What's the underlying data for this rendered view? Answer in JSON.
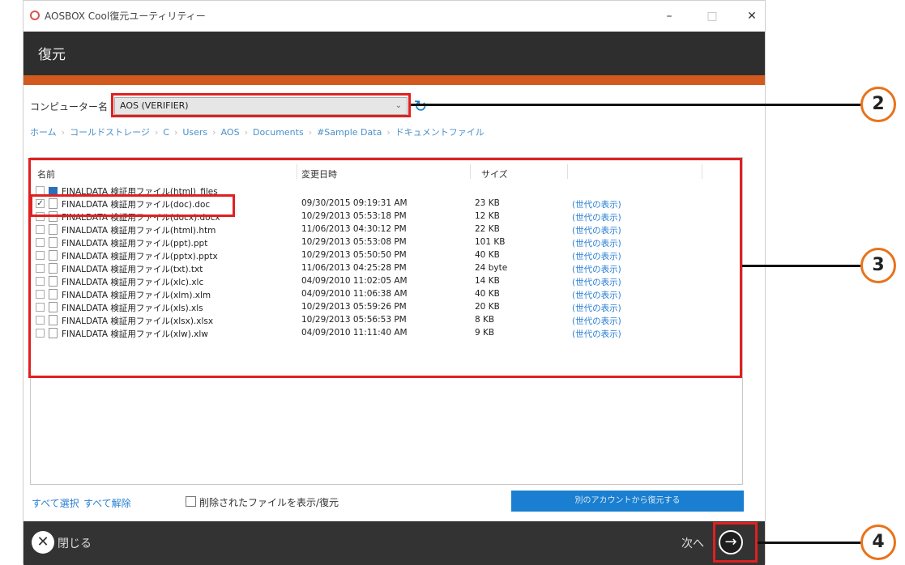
{
  "window": {
    "title": "AOSBOX Cool復元ユーティリティー",
    "minimize": "–",
    "maximize": "□",
    "close": "✕"
  },
  "header": {
    "title": "復元"
  },
  "computer": {
    "label": "コンピューター名",
    "selected": "AOS (VERIFIER)",
    "refresh_glyph": "↻"
  },
  "breadcrumb": [
    "ホーム",
    "コールドストレージ",
    "C",
    "Users",
    "AOS",
    "Documents",
    "#Sample Data",
    "ドキュメントファイル"
  ],
  "table": {
    "headers": {
      "name": "名前",
      "modified": "変更日時",
      "size": "サイズ"
    },
    "rows": [
      {
        "name": "FINALDATA 検証用ファイル(html)_files",
        "date": "",
        "size": "",
        "gen": "",
        "folder": true,
        "checked": false
      },
      {
        "name": "FINALDATA 検証用ファイル(doc).doc",
        "date": "09/30/2015 09:19:31 AM",
        "size": "23 KB",
        "gen": "(世代の表示)",
        "folder": false,
        "checked": true
      },
      {
        "name": "FINALDATA 検証用ファイル(docx).docx",
        "date": "10/29/2013 05:53:18 PM",
        "size": "12 KB",
        "gen": "(世代の表示)",
        "folder": false,
        "checked": false
      },
      {
        "name": "FINALDATA 検証用ファイル(html).htm",
        "date": "11/06/2013 04:30:12 PM",
        "size": "22 KB",
        "gen": "(世代の表示)",
        "folder": false,
        "checked": false
      },
      {
        "name": "FINALDATA 検証用ファイル(ppt).ppt",
        "date": "10/29/2013 05:53:08 PM",
        "size": "101 KB",
        "gen": "(世代の表示)",
        "folder": false,
        "checked": false
      },
      {
        "name": "FINALDATA 検証用ファイル(pptx).pptx",
        "date": "10/29/2013 05:50:50 PM",
        "size": "40 KB",
        "gen": "(世代の表示)",
        "folder": false,
        "checked": false
      },
      {
        "name": "FINALDATA 検証用ファイル(txt).txt",
        "date": "11/06/2013 04:25:28 PM",
        "size": "24 byte",
        "gen": "(世代の表示)",
        "folder": false,
        "checked": false
      },
      {
        "name": "FINALDATA 検証用ファイル(xlc).xlc",
        "date": "04/09/2010 11:02:05 AM",
        "size": "14 KB",
        "gen": "(世代の表示)",
        "folder": false,
        "checked": false
      },
      {
        "name": "FINALDATA 検証用ファイル(xlm).xlm",
        "date": "04/09/2010 11:06:38 AM",
        "size": "40 KB",
        "gen": "(世代の表示)",
        "folder": false,
        "checked": false
      },
      {
        "name": "FINALDATA 検証用ファイル(xls).xls",
        "date": "10/29/2013 05:59:26 PM",
        "size": "20 KB",
        "gen": "(世代の表示)",
        "folder": false,
        "checked": false
      },
      {
        "name": "FINALDATA 検証用ファイル(xlsx).xlsx",
        "date": "10/29/2013 05:56:53 PM",
        "size": "8 KB",
        "gen": "(世代の表示)",
        "folder": false,
        "checked": false
      },
      {
        "name": "FINALDATA 検証用ファイル(xlw).xlw",
        "date": "04/09/2010 11:11:40 AM",
        "size": "9 KB",
        "gen": "(世代の表示)",
        "folder": false,
        "checked": false
      }
    ]
  },
  "bottom": {
    "select_all": "すべて選択",
    "clear_all": "すべて解除",
    "show_deleted": "削除されたファイルを表示/復元",
    "restore_other": "別のアカウントから復元する"
  },
  "footer": {
    "close_label": "閉じる",
    "close_glyph": "✕",
    "next_label": "次へ",
    "next_glyph": "→"
  },
  "callouts": [
    "2",
    "3",
    "4"
  ],
  "colors": {
    "accent_orange": "#d35a1f",
    "header_dark": "#2e2e2e",
    "link_blue": "#2a7fd4",
    "button_blue": "#1a7fd0",
    "highlight_red": "#e02020"
  }
}
